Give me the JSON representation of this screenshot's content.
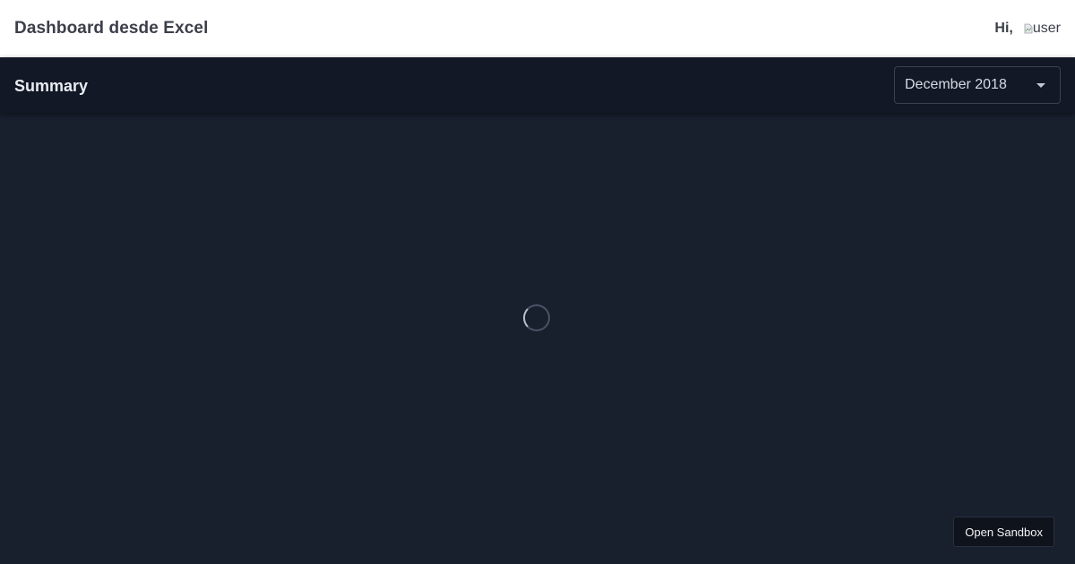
{
  "header": {
    "title": "Dashboard desde Excel",
    "greeting": "Hi,",
    "avatar_alt": "user",
    "avatar_icon": "broken-image-icon"
  },
  "subheader": {
    "title": "Summary",
    "month_select": {
      "selected": "December 2018",
      "icon": "chevron-down-icon"
    }
  },
  "main": {
    "loading_icon": "spinner-icon"
  },
  "sandbox": {
    "label": "Open Sandbox"
  },
  "colors": {
    "header_bg": "#ffffff",
    "subheader_bg": "#121826",
    "content_bg": "#18202e",
    "text_dark": "#3b3f4a",
    "text_light": "#e8ebf2"
  }
}
